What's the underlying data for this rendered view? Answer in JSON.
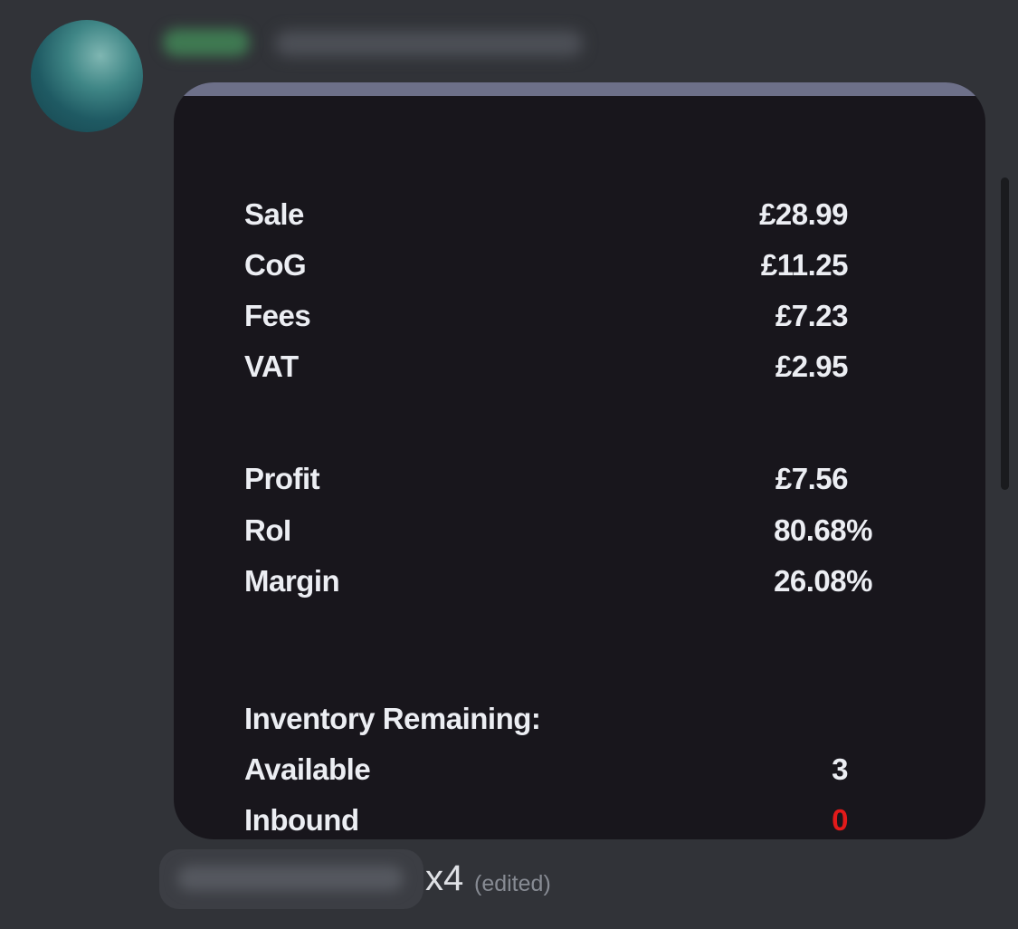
{
  "embed": {
    "accent_color": "#6d7089",
    "rows": [
      {
        "label": "Sale",
        "value": "£28.99"
      },
      {
        "label": "CoG",
        "value": "£11.25"
      },
      {
        "label": "Fees",
        "value": "£7.23"
      },
      {
        "label": "VAT",
        "value": "£2.95"
      },
      {
        "label": "Profit",
        "value": "£7.56"
      },
      {
        "label": "RoI",
        "value": "80.68%"
      },
      {
        "label": "Margin",
        "value": "26.08%"
      }
    ],
    "inventory_heading": "Inventory Remaining:",
    "inventory_rows": [
      {
        "label": "Available",
        "value": "3"
      },
      {
        "label": "Inbound",
        "value": "0",
        "color": "#e21a1a"
      }
    ]
  },
  "footer": {
    "count": "x4",
    "edited": "(edited)"
  }
}
